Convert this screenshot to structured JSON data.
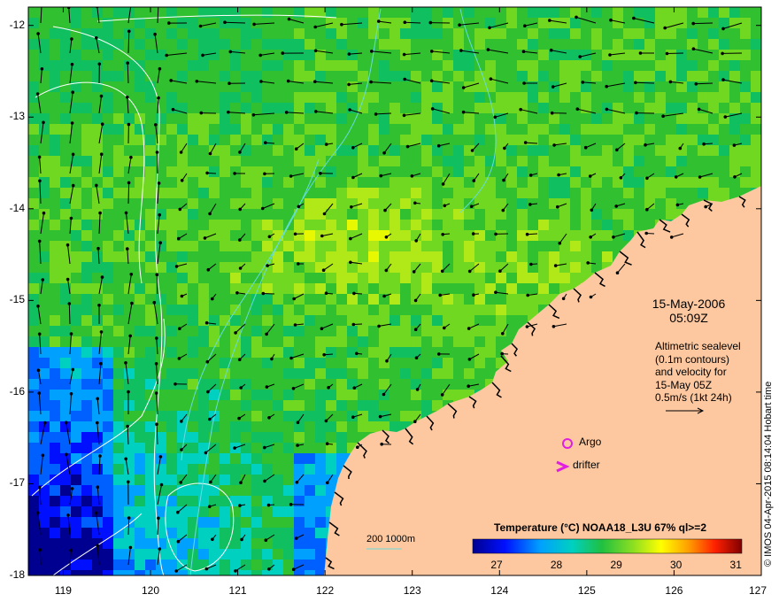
{
  "map": {
    "lon_range": [
      118.6,
      127.0
    ],
    "lat_range": [
      -18.0,
      -11.8
    ],
    "x_ticks": [
      "119",
      "120",
      "121",
      "122",
      "123",
      "124",
      "125",
      "126",
      "127"
    ],
    "y_ticks": [
      "-12",
      "-13",
      "-14",
      "-15",
      "-16",
      "-17",
      "-18"
    ],
    "land_color": "#fdc8a0",
    "coast_color": "#000000",
    "contour_color": "#ffffff",
    "bathy_color": "#66dddd"
  },
  "date_label": {
    "line1": "15-May-2006",
    "line2": "05:09Z"
  },
  "annotation": {
    "lines": [
      "Altimetric sealevel",
      "(0.1m contours)",
      "and velocity for",
      "15-May 05Z",
      "0.5m/s (1kt 24h)"
    ]
  },
  "credit": "© IMOS 04-Apr-2015 08:14:04 Hobart time",
  "colorbar": {
    "title": "Temperature (°C) NOAA18_L3U 67% ql>=2",
    "ticks": [
      "27",
      "28",
      "29",
      "30",
      "31"
    ],
    "range": [
      26.6,
      31.1
    ]
  },
  "legend": {
    "argo_label": "Argo",
    "drifter_label": "drifter",
    "marker_color": "#e020e0",
    "depth_label": "200  1000m"
  }
}
